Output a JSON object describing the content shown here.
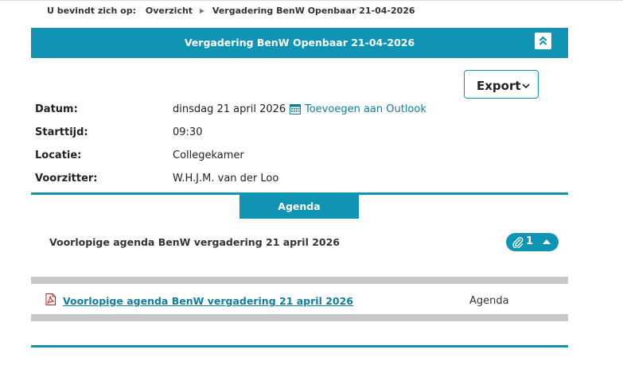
{
  "breadcrumb": {
    "label": "U bevindt zich op:",
    "items": [
      "Overzicht",
      "Vergadering BenW Openbaar 21-04-2026"
    ]
  },
  "header": {
    "title": "Vergadering BenW Openbaar 21-04-2026"
  },
  "export": {
    "label": "Export"
  },
  "details": {
    "datum_label": "Datum:",
    "datum_value": "dinsdag 21 april 2026",
    "outlook_link": "Toevoegen aan Outlook",
    "starttijd_label": "Starttijd:",
    "starttijd_value": "09:30",
    "locatie_label": "Locatie:",
    "locatie_value": "Collegekamer",
    "voorzitter_label": "Voorzitter:",
    "voorzitter_value": "W.H.J.M. van der Loo"
  },
  "tabs": {
    "agenda": "Agenda"
  },
  "agenda": {
    "item_title": "Voorlopige agenda BenW vergadering 21 april 2026",
    "attachment_count": "1",
    "documents": [
      {
        "name": "Voorlopige agenda BenW vergadering 21 april 2026",
        "type": "Agenda",
        "icon": "pdf-icon"
      }
    ]
  },
  "colors": {
    "accent": "#0f94b4",
    "link": "#0f7fa0",
    "divider": "#c8c8c8"
  }
}
